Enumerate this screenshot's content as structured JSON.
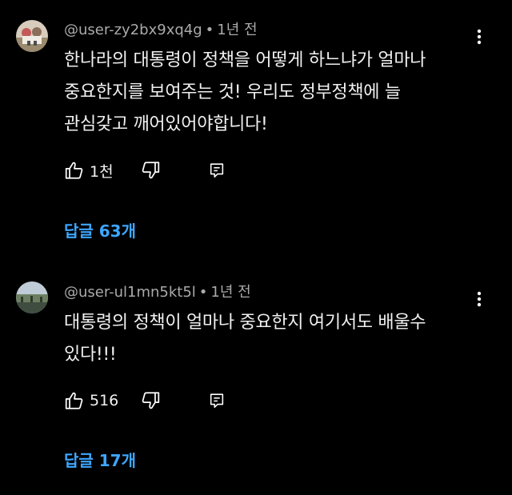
{
  "colors": {
    "background": "#000000",
    "meta_text": "#aaaaaa",
    "body_text": "#f1f1f1",
    "replies_link": "#3ea6ff"
  },
  "comments": [
    {
      "handle": "@user-zy2bx9xq4g",
      "separator": "•",
      "time": "1년 전",
      "text": "한나라의 대통령이 정책을 어떻게 하느냐가 얼마나\n중요한지를 보여주는 것! 우리도 정부정책에 늘\n관심갖고   깨어있어야합니다!",
      "like_count": "1천",
      "icons": [
        "avatar",
        "kebab-menu-icon",
        "thumbs-up-icon",
        "thumbs-down-icon",
        "reply-icon"
      ],
      "replies_label": "답글 63개"
    },
    {
      "handle": "@user-ul1mn5kt5l",
      "separator": "•",
      "time": "1년 전",
      "text": "대통령의 정책이 얼마나 중요한지 여기서도 배울수\n있다!!!",
      "like_count": "516",
      "icons": [
        "avatar",
        "kebab-menu-icon",
        "thumbs-up-icon",
        "thumbs-down-icon",
        "reply-icon"
      ],
      "replies_label": "답글 17개"
    }
  ]
}
